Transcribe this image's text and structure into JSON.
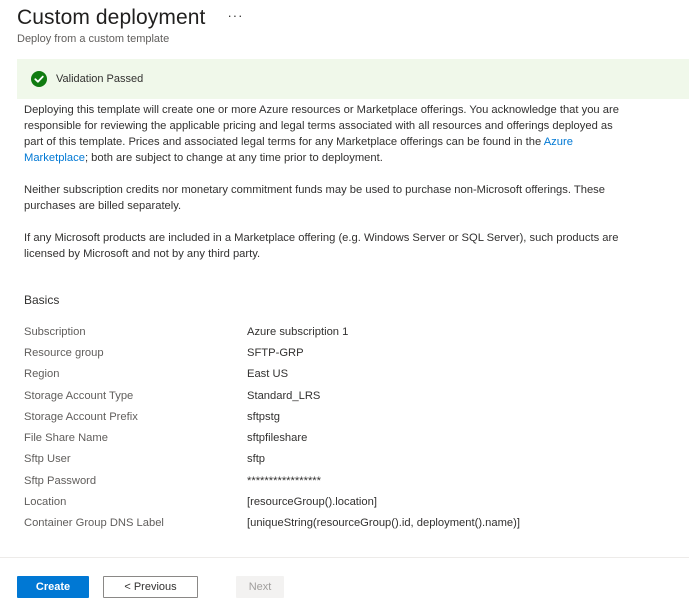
{
  "header": {
    "title": "Custom deployment",
    "more": "···",
    "subtitle": "Deploy from a custom template"
  },
  "validation": {
    "text": "Validation Passed",
    "color": "#107c10"
  },
  "notice": {
    "p1_before": "Deploying this template will create one or more Azure resources or Marketplace offerings.  You acknowledge that you are responsible for reviewing the applicable pricing and legal terms associated with all resources and offerings deployed as part of this template.  Prices and associated legal terms for any Marketplace offerings can be found in the ",
    "p1_link": "Azure Marketplace",
    "p1_after": "; both are subject to change at any time prior to deployment.",
    "p2": "Neither subscription credits nor monetary commitment funds may be used to purchase non-Microsoft offerings. These purchases are billed separately.",
    "p3": "If any Microsoft products are included in a Marketplace offering (e.g. Windows Server or SQL Server), such products are licensed by Microsoft and not by any third party."
  },
  "basics": {
    "title": "Basics",
    "rows": [
      {
        "label": "Subscription",
        "value": "Azure subscription 1"
      },
      {
        "label": "Resource group",
        "value": "SFTP-GRP"
      },
      {
        "label": "Region",
        "value": "East US"
      },
      {
        "label": "Storage Account Type",
        "value": "Standard_LRS"
      },
      {
        "label": "Storage Account Prefix",
        "value": "sftpstg"
      },
      {
        "label": "File Share Name",
        "value": "sftpfileshare"
      },
      {
        "label": "Sftp User",
        "value": "sftp"
      },
      {
        "label": "Sftp Password",
        "value": "*****************"
      },
      {
        "label": "Location",
        "value": "[resourceGroup().location]"
      },
      {
        "label": "Container Group DNS Label",
        "value": "[uniqueString(resourceGroup().id, deployment().name)]"
      }
    ]
  },
  "footer": {
    "create_label": "Create",
    "previous_label": "< Previous",
    "next_label": "Next"
  }
}
